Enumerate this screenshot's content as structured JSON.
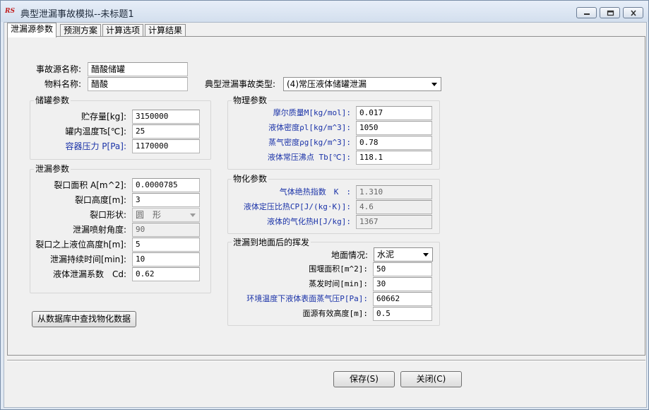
{
  "window": {
    "title": "典型泄漏事故模拟--未标题1",
    "app_icon_text": "RS"
  },
  "tabs": [
    {
      "label": "泄漏源参数",
      "active": true
    },
    {
      "label": "预测方案",
      "active": false
    },
    {
      "label": "计算选项",
      "active": false
    },
    {
      "label": "计算结果",
      "active": false
    }
  ],
  "accident": {
    "source_name_label": "事故源名称:",
    "source_name_value": "醋酸储罐",
    "material_label": "物料名称:",
    "material_value": "醋酸",
    "type_label": "典型泄漏事故类型:",
    "type_value": "(4)常压液体储罐泄漏"
  },
  "storage": {
    "title": "储罐参数",
    "fields": [
      {
        "label": "贮存量[kg]:",
        "value": "3150000"
      },
      {
        "label": "罐内温度Ts[℃]:",
        "value": "25"
      },
      {
        "label": "容器压力 P[Pa]:",
        "value": "1170000"
      }
    ]
  },
  "leak": {
    "title": "泄漏参数",
    "fields": [
      {
        "label": "裂口面积 A[m^2]:",
        "value": "0.0000785"
      },
      {
        "label": "裂口高度[m]:",
        "value": "3"
      },
      {
        "label": "裂口形状:",
        "value": "圆　形"
      },
      {
        "label": "泄漏喷射角度:",
        "value": "90"
      },
      {
        "label": "裂口之上液位高度h[m]:",
        "value": "5"
      },
      {
        "label": "泄漏持续时间[min]:",
        "value": "10"
      },
      {
        "label": "液体泄漏系数　Cd:",
        "value": "0.62"
      }
    ]
  },
  "physical": {
    "title": "物理参数",
    "fields": [
      {
        "label": "摩尔质量M[kg/mol]:",
        "value": "0.017"
      },
      {
        "label": "液体密度ρl[kg/m^3]:",
        "value": "1050"
      },
      {
        "label": "蒸气密度ρg[kg/m^3]:",
        "value": "0.78"
      },
      {
        "label": "液体常压沸点 Tb[℃]:",
        "value": "118.1"
      }
    ]
  },
  "physchem": {
    "title": "物化参数",
    "fields": [
      {
        "label": "气体绝热指数　K　:",
        "value": "1.310"
      },
      {
        "label": "液体定压比热CP[J/(kg·K)]:",
        "value": "4.6"
      },
      {
        "label": "液体的气化热H[J/kg]:",
        "value": "1367"
      }
    ]
  },
  "evaporation": {
    "title": "泄漏到地面后的挥发",
    "ground_label": "地面情况:",
    "ground_value": "水泥",
    "fields": [
      {
        "label": "围堰面积[m^2]:",
        "value": "50"
      },
      {
        "label": "蒸发时间[min]:",
        "value": "30"
      },
      {
        "label": "环境温度下液体表面蒸气压P[Pa]:",
        "value": "60662"
      },
      {
        "label": "面源有效高度[m]:",
        "value": "0.5"
      }
    ]
  },
  "buttons": {
    "lookup": "从数据库中查找物化数据",
    "save": "保存(S)",
    "close": "关闭(C)"
  },
  "colors": {
    "blue_label": "#1b33a8",
    "window_frame": "#dfe8f3",
    "panel": "#f0f0f0"
  }
}
